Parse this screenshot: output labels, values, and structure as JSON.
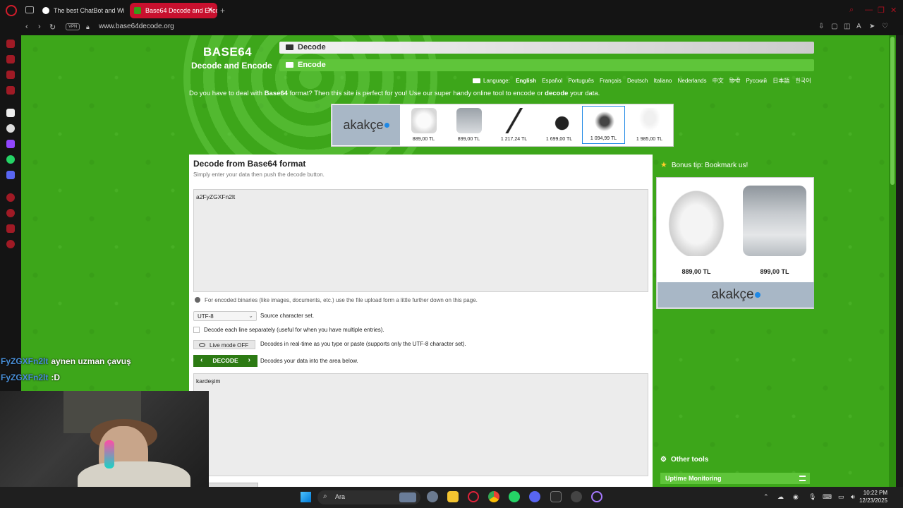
{
  "browser": {
    "tabs": [
      {
        "title": "The best ChatBot and Wi"
      },
      {
        "title": "Base64 Decode and Enco"
      }
    ],
    "vpn_label": "VPN",
    "url": "www.base64decode.org"
  },
  "site": {
    "logo_title": "BASE64",
    "logo_sub": "Decode and Encode",
    "nav": {
      "decode": "Decode",
      "encode": "Encode"
    },
    "language_label": "Language:",
    "languages": [
      "English",
      "Español",
      "Português",
      "Français",
      "Deutsch",
      "Italiano",
      "Nederlands",
      "中文",
      "हिन्दी",
      "Русский",
      "日本語",
      "한국어"
    ],
    "intro": {
      "p1": "Do you have to deal with ",
      "b1": "Base64",
      "p2": " format? Then this site is perfect for you! Use our super handy online tool to encode or ",
      "b2": "decode",
      "p3": " your data."
    },
    "ad": {
      "logo": "akakçe",
      "prices": [
        "889,00 TL",
        "899,00 TL",
        "1 217,24 TL",
        "1 699,00 TL",
        "1 094,99 TL",
        "1 985,00 TL"
      ]
    },
    "panel": {
      "title": "Decode from Base64 format",
      "subtitle": "Simply enter your data then push the decode button.",
      "input_value": "a2FyZGXFn2lt",
      "info": "For encoded binaries (like images, documents, etc.) use the file upload form a little further down on this page.",
      "charset_value": "UTF-8",
      "charset_label": "Source character set.",
      "each_line_label": "Decode each line separately (useful for when you have multiple entries).",
      "live_mode": "Live mode OFF",
      "live_desc": "Decodes in real-time as you type or paste (supports only the UTF-8 character set).",
      "decode_button": "DECODE",
      "decode_desc": "Decodes your data into the area below.",
      "output_value": "kardeşim"
    },
    "sidebar": {
      "tip": "Bonus tip: Bookmark us!",
      "ad_prices": [
        "889,00 TL",
        "899,00 TL"
      ],
      "ad_logo": "akakçe",
      "other_tools": "Other tools",
      "uptime": "Uptime Monitoring"
    }
  },
  "stream": {
    "chat": [
      {
        "user": "FyZGXFn2lt",
        "msg": "aynen uzman çavuş"
      },
      {
        "user": "FyZGXFn2lt",
        "msg": ":D"
      }
    ]
  },
  "taskbar": {
    "search": "Ara",
    "time": "10:22 PM",
    "date": "12/23/2025"
  },
  "colors": {
    "site_green": "#3da61a",
    "nav_green": "#5fc53a",
    "decode_button": "#2c7a13",
    "active_tab": "#c8102e",
    "chat_user": "#4a90d9"
  }
}
